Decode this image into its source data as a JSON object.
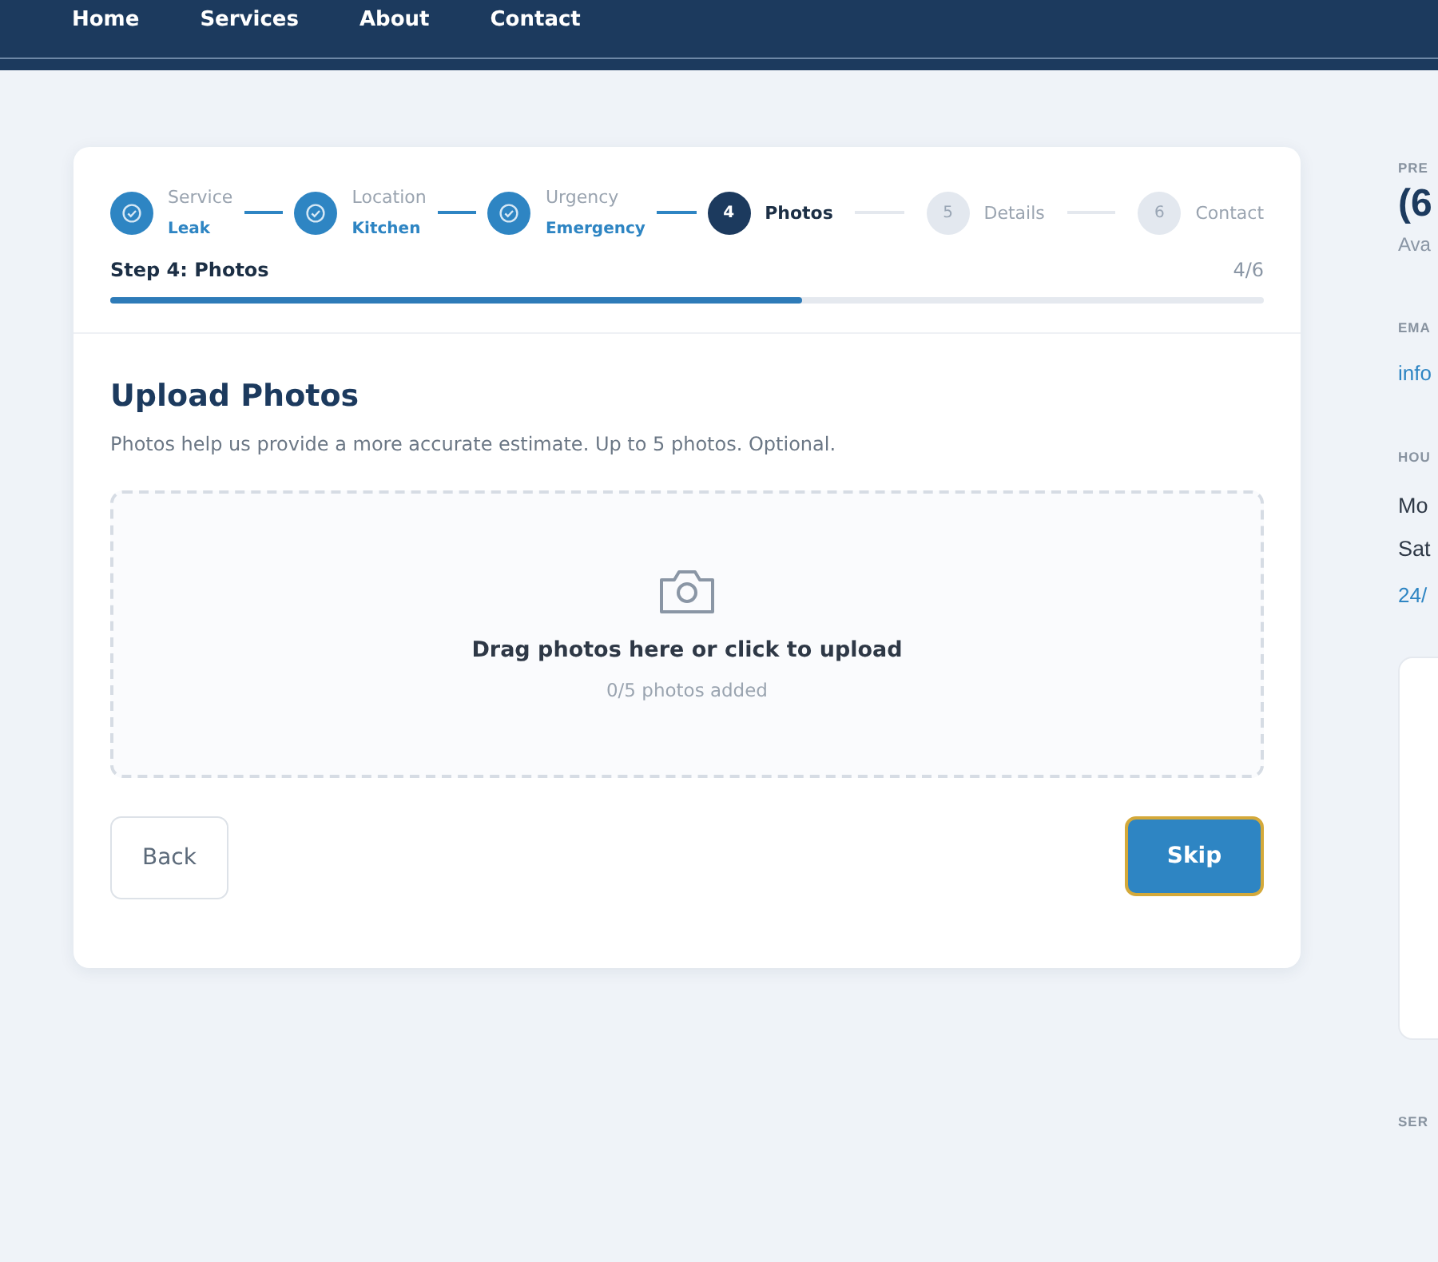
{
  "nav": [
    {
      "label": "Home"
    },
    {
      "label": "Services"
    },
    {
      "label": "About"
    },
    {
      "label": "Contact"
    }
  ],
  "steps": [
    {
      "kind": "done",
      "title": "Service",
      "value": "Leak"
    },
    {
      "kind": "done",
      "title": "Location",
      "value": "Kitchen"
    },
    {
      "kind": "done",
      "title": "Urgency",
      "value": "Emergency"
    },
    {
      "kind": "current",
      "number": "4",
      "title": "Photos"
    },
    {
      "kind": "upcoming",
      "number": "5",
      "title": "Details"
    },
    {
      "kind": "upcoming",
      "number": "6",
      "title": "Contact"
    }
  ],
  "progress": {
    "label": "Step 4: Photos",
    "count": "4/6",
    "level": 0.6
  },
  "heading": "Upload Photos",
  "description": "Photos help us provide a more accurate estimate. Up to 5 photos. Optional.",
  "dropzone": {
    "prompt": "Drag photos here or click to upload",
    "count": "0/5 photos added"
  },
  "buttons": {
    "back": "Back",
    "next": "Skip"
  },
  "sidebar": {
    "phone_label": "PRE",
    "phone": "(6",
    "phone_note": "Ava",
    "email_label": "EMA",
    "email": "info",
    "hours_label": "HOU",
    "hours": [
      "Mo",
      "Sat"
    ],
    "hours_note": "24/",
    "services_label": "SER"
  }
}
